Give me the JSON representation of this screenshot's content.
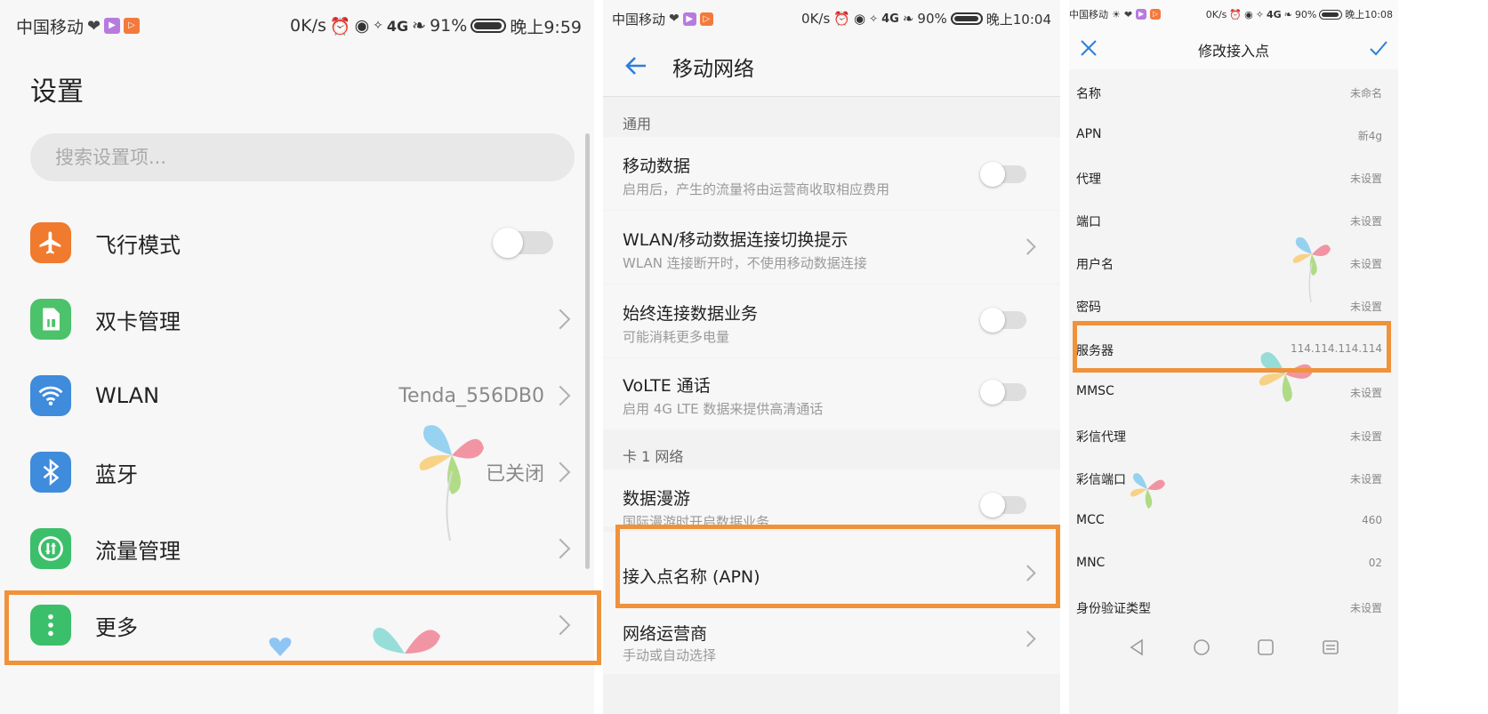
{
  "colors": {
    "accent": "#2b7fd8",
    "highlight": "#f0923a",
    "airplane": "#f07a2d",
    "sim": "#4cc26a",
    "wlan": "#3f8bdc",
    "bluetooth": "#3f8bdc",
    "traffic": "#3cbf6a",
    "more": "#3cbf6a"
  },
  "panel1": {
    "status": {
      "carrier": "中国移动",
      "speed": "0K/s",
      "network": "4G",
      "battery": "91%",
      "time": "晚上9:59",
      "battery_level": 0.91
    },
    "title": "设置",
    "search_placeholder": "搜索设置项...",
    "items": [
      {
        "label": "飞行模式",
        "value": "",
        "control": "toggle",
        "on": false,
        "icon": "airplane-icon"
      },
      {
        "label": "双卡管理",
        "value": "",
        "control": "chevron",
        "icon": "sim-card-icon"
      },
      {
        "label": "WLAN",
        "value": "Tenda_556DB0",
        "control": "chevron",
        "icon": "wifi-icon"
      },
      {
        "label": "蓝牙",
        "value": "已关闭",
        "control": "chevron",
        "icon": "bluetooth-icon"
      },
      {
        "label": "流量管理",
        "value": "",
        "control": "chevron",
        "icon": "data-usage-icon"
      },
      {
        "label": "更多",
        "value": "",
        "control": "chevron",
        "icon": "more-vertical-icon"
      }
    ]
  },
  "panel2": {
    "status": {
      "carrier": "中国移动",
      "speed": "0K/s",
      "network": "4G",
      "battery": "90%",
      "time": "晚上10:04",
      "battery_level": 0.9
    },
    "title": "移动网络",
    "section_general": "通用",
    "section_card": "卡 1 网络",
    "items": [
      {
        "title": "移动数据",
        "subtitle": "启用后，产生的流量将由运营商收取相应费用",
        "control": "toggle",
        "on": false
      },
      {
        "title": "WLAN/移动数据连接切换提示",
        "subtitle": "WLAN 连接断开时，不使用移动数据连接",
        "control": "chevron"
      },
      {
        "title": "始终连接数据业务",
        "subtitle": "可能消耗更多电量",
        "control": "toggle",
        "on": false
      },
      {
        "title": "VoLTE 通话",
        "subtitle": "启用 4G LTE 数据来提供高清通话",
        "control": "toggle",
        "on": false
      },
      {
        "title": "数据漫游",
        "subtitle": "国际漫游时开启数据业务",
        "control": "toggle",
        "on": false
      },
      {
        "title": "接入点名称 (APN)",
        "subtitle": "",
        "control": "chevron"
      },
      {
        "title": "网络运营商",
        "subtitle": "手动或自动选择",
        "control": "chevron"
      }
    ]
  },
  "panel3": {
    "status": {
      "carrier": "中国移动",
      "speed": "0K/s",
      "network": "4G",
      "battery": "90%",
      "time": "晚上10:08",
      "battery_level": 0.9
    },
    "title": "修改接入点",
    "fields": [
      {
        "key": "名称",
        "value": "未命名"
      },
      {
        "key": "APN",
        "value": "新4g"
      },
      {
        "key": "代理",
        "value": "未设置"
      },
      {
        "key": "端口",
        "value": "未设置"
      },
      {
        "key": "用户名",
        "value": "未设置"
      },
      {
        "key": "密码",
        "value": "未设置"
      },
      {
        "key": "服务器",
        "value": "114.114.114.114"
      },
      {
        "key": "MMSC",
        "value": "未设置"
      },
      {
        "key": "彩信代理",
        "value": "未设置"
      },
      {
        "key": "彩信端口",
        "value": "未设置"
      },
      {
        "key": "MCC",
        "value": "460"
      },
      {
        "key": "MNC",
        "value": "02"
      },
      {
        "key": "身份验证类型",
        "value": "未设置"
      }
    ]
  }
}
